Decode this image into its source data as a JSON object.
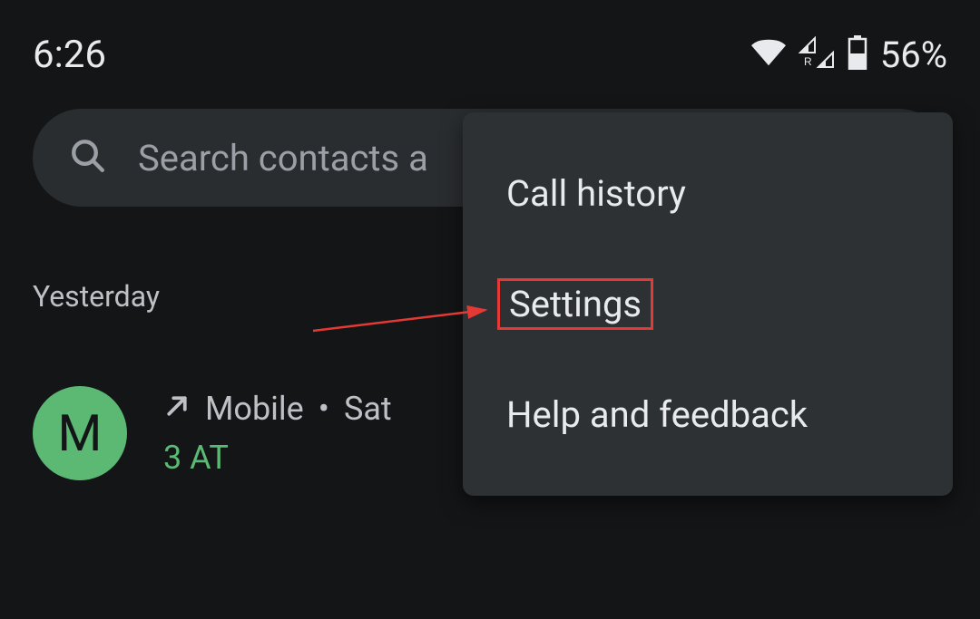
{
  "statusBar": {
    "time": "6:26",
    "batteryText": "56%"
  },
  "search": {
    "placeholder": "Search contacts a"
  },
  "section": {
    "header": "Yesterday"
  },
  "callItem": {
    "avatarLetter": "M",
    "callType": "Mobile",
    "separator": "•",
    "day": "Sat",
    "carrier": "3 AT"
  },
  "menu": {
    "callHistory": "Call history",
    "settings": "Settings",
    "helpFeedback": "Help and feedback"
  }
}
